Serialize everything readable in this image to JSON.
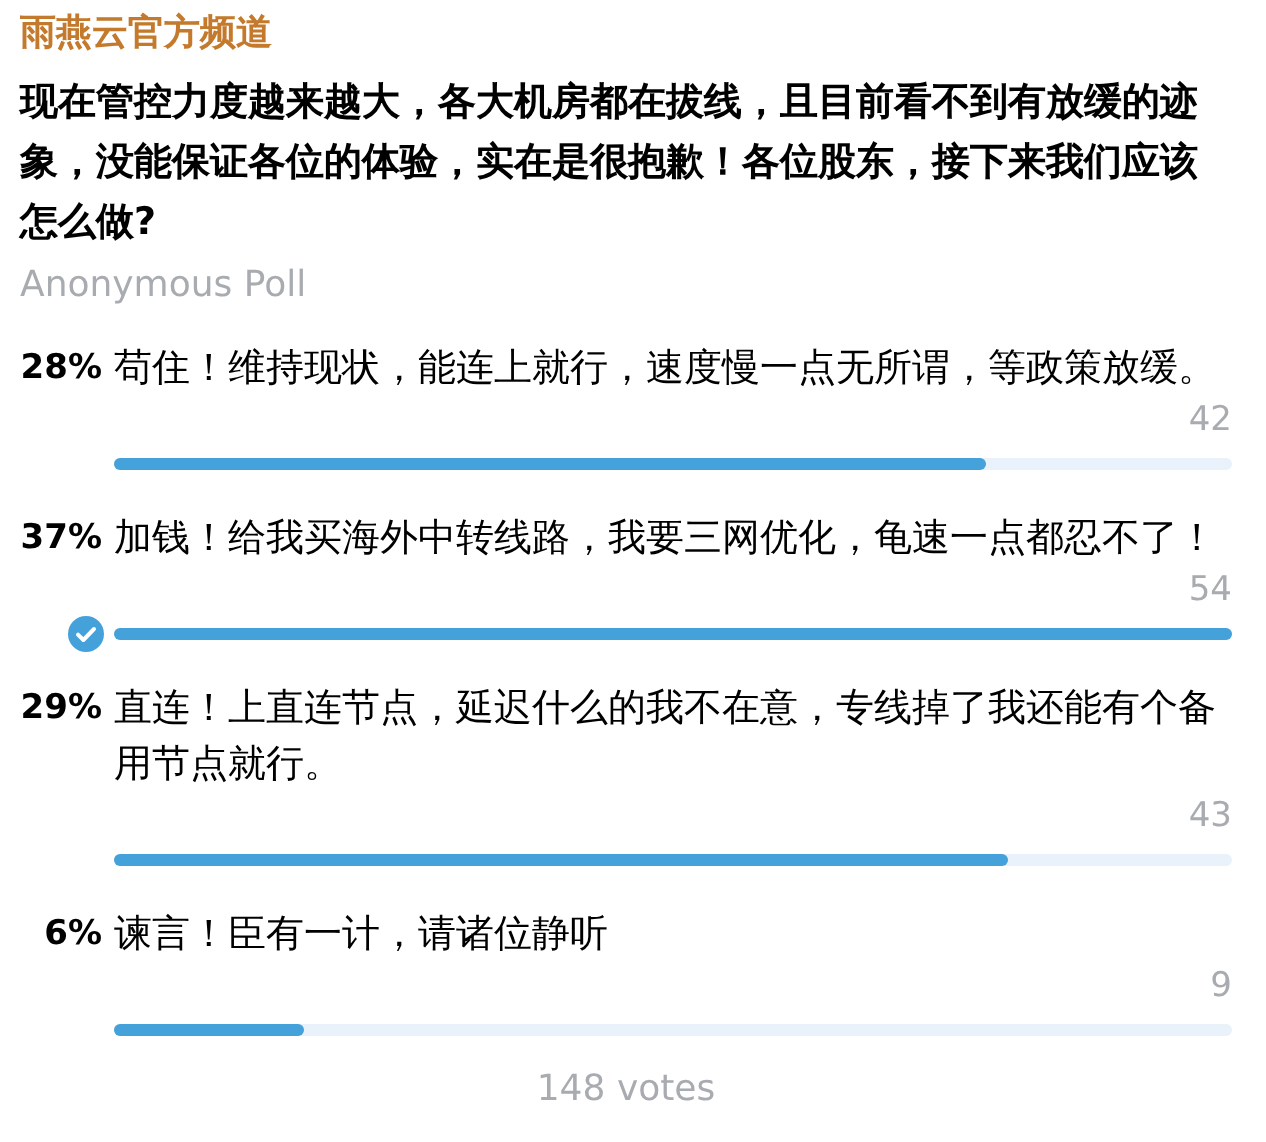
{
  "channel": {
    "title": "雨燕云官方频道"
  },
  "poll": {
    "question": "现在管控力度越来越大，各大机房都在拔线，且目前看不到有放缓的迹象，没能保证各位的体验，实在是很抱歉！各位股东，接下来我们应该怎么做?",
    "type_label": "Anonymous Poll",
    "options": [
      {
        "percent": "28%",
        "text": "苟住！维持现状，能连上就行，速度慢一点无所谓，等政策放缓。",
        "count": "42",
        "level": 0.78,
        "selected": false
      },
      {
        "percent": "37%",
        "text": "加钱！给我买海外中转线路，我要三网优化，龟速一点都忍不了！",
        "count": "54",
        "level": 1.0,
        "selected": true
      },
      {
        "percent": "29%",
        "text": "直连！上直连节点，延迟什么的我不在意，专线掉了我还能有个备用节点就行。",
        "count": "43",
        "level": 0.8,
        "selected": false
      },
      {
        "percent": "6%",
        "text": "谏言！臣有一计，请诸位静听",
        "count": "9",
        "level": 0.17,
        "selected": false
      }
    ],
    "total": "148 votes"
  }
}
